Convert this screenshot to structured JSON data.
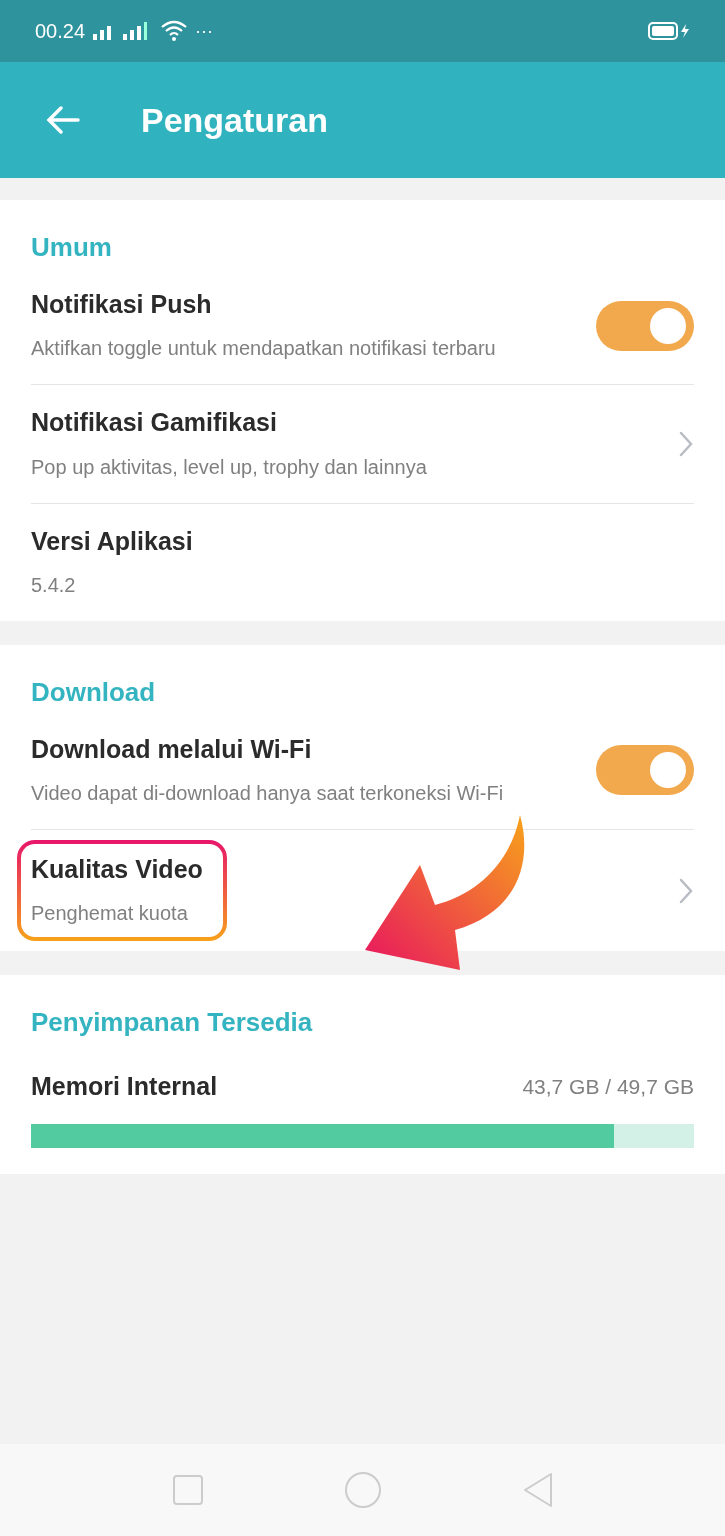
{
  "status_bar": {
    "time": "00.24",
    "dots": "···"
  },
  "app_bar": {
    "title": "Pengaturan"
  },
  "sections": [
    {
      "title": "Umum",
      "items": [
        {
          "kind": "toggle",
          "title": "Notifikasi Push",
          "subtitle": "Aktifkan toggle untuk mendapatkan notifikasi terbaru",
          "on": true,
          "highlighted": false
        },
        {
          "kind": "link",
          "title": "Notifikasi Gamifikasi",
          "subtitle": "Pop up aktivitas, level up, trophy dan lainnya",
          "highlighted": false
        },
        {
          "kind": "info",
          "title": "Versi Aplikasi",
          "subtitle": "5.4.2",
          "highlighted": false
        }
      ]
    },
    {
      "title": "Download",
      "items": [
        {
          "kind": "toggle",
          "title": "Download melalui Wi-Fi",
          "subtitle": "Video dapat di-download hanya saat terkoneksi Wi-Fi",
          "on": true,
          "highlighted": false
        },
        {
          "kind": "link",
          "title": "Kualitas Video",
          "subtitle": "Penghemat kuota",
          "highlighted": true
        }
      ]
    },
    {
      "title": "Penyimpanan Tersedia",
      "items": [
        {
          "kind": "storage",
          "title": "Memori Internal",
          "reading": "43,7 GB / 49,7 GB",
          "level": 0.88
        }
      ]
    }
  ]
}
